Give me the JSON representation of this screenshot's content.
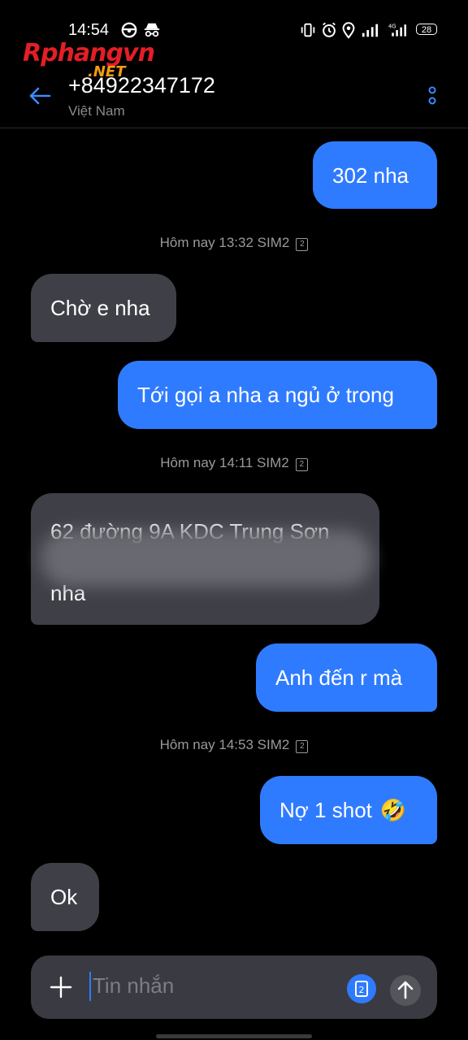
{
  "status_bar": {
    "time": "14:54",
    "battery": "28",
    "network": "4G"
  },
  "watermark": {
    "brand": "Rphangvn",
    "suffix": ".NET"
  },
  "header": {
    "phone": "+84922347172",
    "country": "Việt Nam"
  },
  "messages": [
    {
      "direction": "out",
      "text": "302 nha"
    },
    {
      "type": "meta",
      "text": "Hôm nay 13:32  SIM2",
      "sim": "2"
    },
    {
      "direction": "in",
      "text": "Chờ e nha"
    },
    {
      "direction": "out",
      "text": "Tới gọi a nha a ngủ ở trong"
    },
    {
      "type": "meta",
      "text": "Hôm nay 14:11  SIM2",
      "sim": "2"
    },
    {
      "direction": "in",
      "line1": "62 đường 9A KDC Trung Sơn",
      "line3": "nha"
    },
    {
      "direction": "out",
      "text": "Anh đến r mà"
    },
    {
      "type": "meta",
      "text": "Hôm nay 14:53  SIM2",
      "sim": "2"
    },
    {
      "direction": "out",
      "text": "Nợ 1 shot",
      "emoji": "🤣"
    },
    {
      "direction": "in",
      "text": "Ok"
    }
  ],
  "composer": {
    "placeholder": "Tin nhắn",
    "sim_label": "2"
  }
}
